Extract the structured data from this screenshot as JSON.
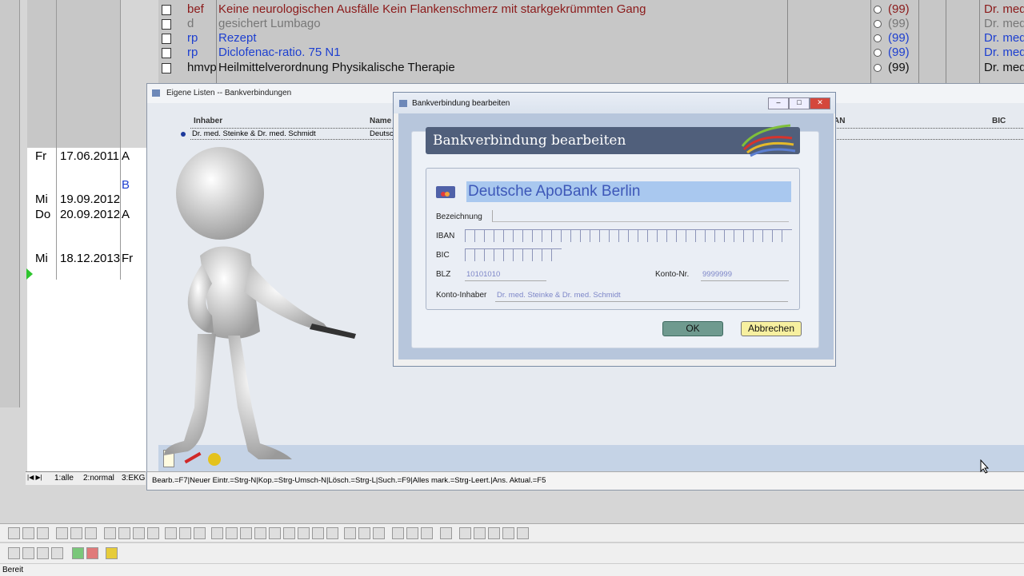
{
  "entries": [
    {
      "key": "bef",
      "text": "Keine neurologischen Ausfälle Kein Flankenschmerz mit starkgekrümmten Gang",
      "num": "(99)",
      "doctor": "Dr. med",
      "color": "#8b1a1a"
    },
    {
      "key": "d",
      "text": "gesichert Lumbago",
      "num": "(99)",
      "doctor": "Dr. med",
      "color": "#777777"
    },
    {
      "key": "rp",
      "text": "Rezept",
      "num": "(99)",
      "doctor": "Dr. med",
      "color": "#1d3fd0"
    },
    {
      "key": "rp",
      "text": "Diclofenac-ratio. 75  N1",
      "num": "(99)",
      "doctor": "Dr. med",
      "color": "#1d3fd0"
    },
    {
      "key": "hmvp",
      "text": "Heilmittelverordnung Physikalische Therapie",
      "num": "(99)",
      "doctor": "Dr. med",
      "color": "#111111"
    }
  ],
  "dates": [
    {
      "day": "Fr",
      "date": "17.06.2011",
      "code": "A"
    },
    {
      "day": "",
      "date": "",
      "code": "B"
    },
    {
      "day": "Mi",
      "date": "19.09.2012",
      "code": ""
    },
    {
      "day": "Do",
      "date": "20.09.2012",
      "code": "A"
    },
    {
      "day": "Mi",
      "date": "18.12.2013",
      "code": "Fr"
    }
  ],
  "lists_window": {
    "title": "Eigene Listen -- Bankverbindungen",
    "col_inhaber": "Inhaber",
    "col_name": "Name",
    "col_iban": "AN",
    "col_bic": "BIC",
    "row_inhaber": "Dr. med. Steinke & Dr. med. Schmidt",
    "row_name": "Deutsc",
    "status": "Bearb.=F7|Neuer Eintr.=Strg-N|Kop.=Strg-Umsch-N|Lösch.=Strg-L|Such.=F9|Alles mark.=Strg-Leert.|Ans. Aktual.=F5"
  },
  "tabs": [
    "1:alle",
    "2:normal",
    "3:EKG"
  ],
  "dialog": {
    "window_title": "Bankverbindung bearbeiten",
    "banner": "Bankverbindung bearbeiten",
    "bank_name": "Deutsche ApoBank Berlin",
    "lbl_bezeichnung": "Bezeichnung",
    "lbl_iban": "IBAN",
    "lbl_bic": "BIC",
    "lbl_blz": "BLZ",
    "blz": "10101010",
    "lbl_konto": "Konto-Nr.",
    "konto": "9999999",
    "lbl_inhaber": "Konto-Inhaber",
    "inhaber": "Dr. med. Steinke & Dr. med. Schmidt",
    "ok": "OK",
    "cancel": "Abbrechen"
  },
  "statusbar": "Bereit"
}
